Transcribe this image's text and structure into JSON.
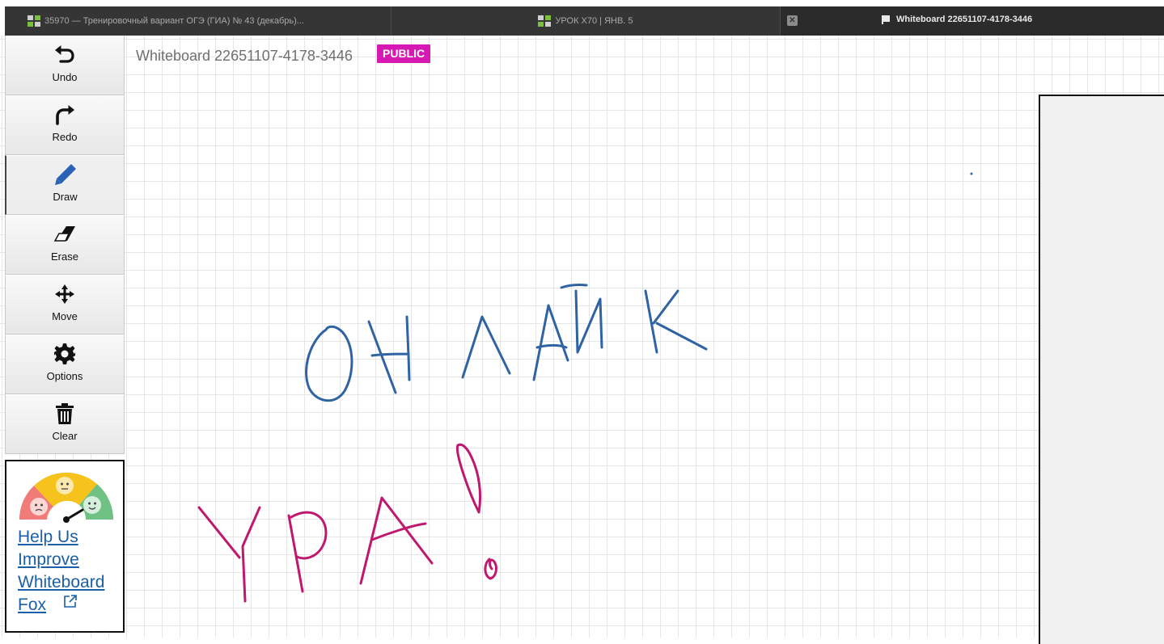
{
  "browser": {
    "tabs": [
      {
        "label": "35970 — Тренировочный вариант ОГЭ (ГИА) № 43 (декабрь)..."
      },
      {
        "label": "УРОК Х70 | ЯНВ. 5"
      },
      {
        "label": "Whiteboard 22651107-4178-3446"
      }
    ]
  },
  "board": {
    "title": "Whiteboard 22651107-4178-3446",
    "visibility_badge": "PUBLIC"
  },
  "toolbar": {
    "undo": "Undo",
    "redo": "Redo",
    "draw": "Draw",
    "erase": "Erase",
    "move": "Move",
    "options": "Options",
    "clear": "Clear"
  },
  "feedback": {
    "link_text": "Help Us Improve Whiteboard Fox"
  },
  "ink": {
    "blue": "#2f63a4",
    "magenta": "#c0176f"
  }
}
